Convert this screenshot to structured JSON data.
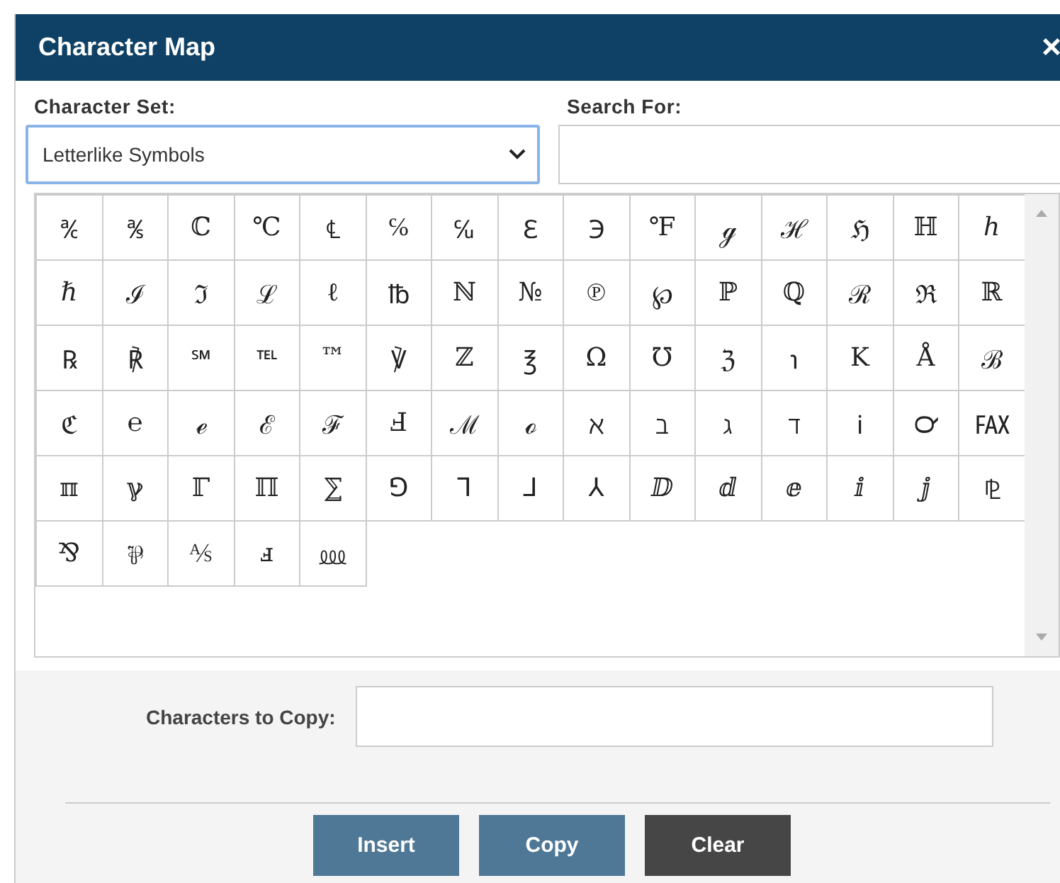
{
  "window": {
    "title": "Character Map",
    "close": "×"
  },
  "character_set": {
    "label": "Character Set:",
    "value": "Letterlike Symbols"
  },
  "search": {
    "label": "Search For:"
  },
  "characters": [
    "℀",
    "℁",
    "ℂ",
    "℃",
    "℄",
    "℅",
    "℆",
    "ℇ",
    "℈",
    "℉",
    "ℊ",
    "ℋ",
    "ℌ",
    "ℍ",
    "ℎ",
    "ℏ",
    "ℐ",
    "ℑ",
    "ℒ",
    "ℓ",
    "℔",
    "ℕ",
    "№",
    "℗",
    "℘",
    "ℙ",
    "ℚ",
    "ℛ",
    "ℜ",
    "ℝ",
    "℞",
    "℟",
    "℠",
    "℡",
    "™",
    "℣",
    "ℤ",
    "℥",
    "Ω",
    "℧",
    "ℨ",
    "℩",
    "K",
    "Å",
    "ℬ",
    "ℭ",
    "℮",
    "ℯ",
    "ℰ",
    "ℱ",
    "Ⅎ",
    "ℳ",
    "ℴ",
    "ℵ",
    "ℶ",
    "ℷ",
    "ℸ",
    "ℹ",
    "℺",
    "℻",
    "ℼ",
    "ℽ",
    "ℾ",
    "ℿ",
    "⅀",
    "⅁",
    "⅂",
    "⅃",
    "⅄",
    "ⅅ",
    "ⅆ",
    "ⅇ",
    "ⅈ",
    "ⅉ",
    "⅊",
    "⅋",
    "⅌",
    "⅍",
    "ⅎ",
    "⅏"
  ],
  "copy_field": {
    "label": "Characters to Copy:"
  },
  "buttons": [
    {
      "label": "Insert",
      "kind": "primary"
    },
    {
      "label": "Copy",
      "kind": "primary"
    },
    {
      "label": "Clear",
      "kind": "dark"
    }
  ]
}
